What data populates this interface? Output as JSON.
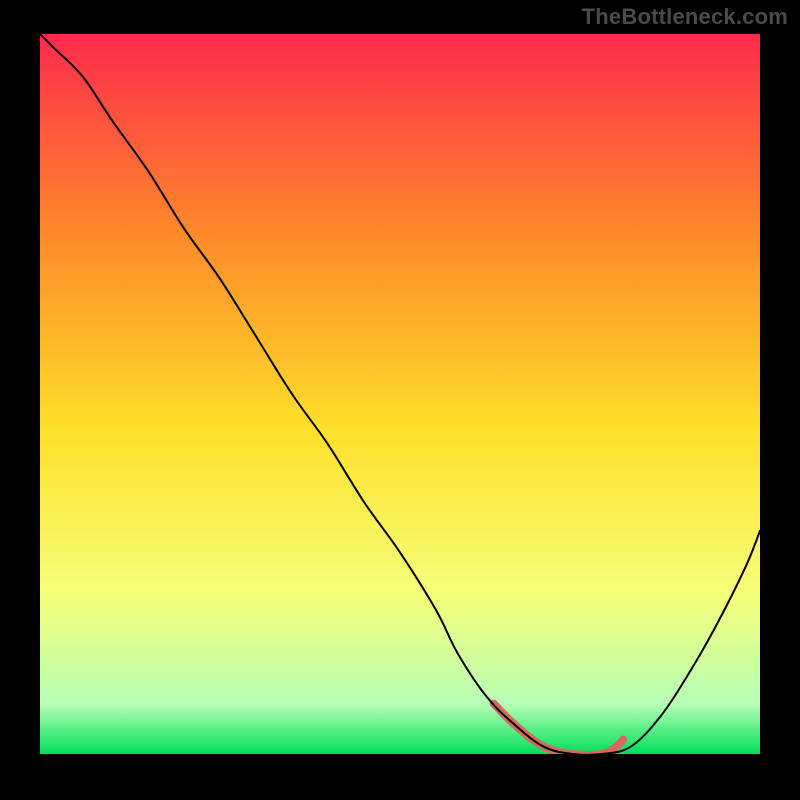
{
  "attribution": "TheBottleneck.com",
  "colors": {
    "frame": "#000000",
    "gradient_top": "#ff2a4c",
    "gradient_mid1": "#ff8a2a",
    "gradient_mid2": "#ffe02a",
    "gradient_mid3": "#f5ff7a",
    "gradient_mid4": "#b6ffb6",
    "gradient_bottom": "#00e05a",
    "curve": "#000000",
    "highlight": "#d66a63"
  },
  "chart_data": {
    "type": "line",
    "title": "",
    "xlabel": "",
    "ylabel": "",
    "xlim": [
      0,
      100
    ],
    "ylim": [
      0,
      100
    ],
    "grid": false,
    "legend": false,
    "series": [
      {
        "name": "curve",
        "x": [
          0,
          2,
          6,
          10,
          15,
          20,
          25,
          30,
          35,
          40,
          45,
          50,
          55,
          58,
          62,
          66,
          70,
          74,
          78,
          82,
          86,
          90,
          94,
          98,
          100
        ],
        "y": [
          100,
          98,
          94,
          88,
          81,
          73,
          66,
          58,
          50,
          43,
          35,
          28,
          20,
          14,
          8,
          4,
          1,
          0,
          0,
          1,
          5,
          11,
          18,
          26,
          31
        ]
      },
      {
        "name": "highlight",
        "x": [
          63,
          66,
          70,
          74,
          78,
          80,
          81
        ],
        "y": [
          7,
          4,
          1,
          0,
          0,
          1,
          2
        ]
      }
    ],
    "highlight_range_x": [
      63,
      81
    ]
  }
}
